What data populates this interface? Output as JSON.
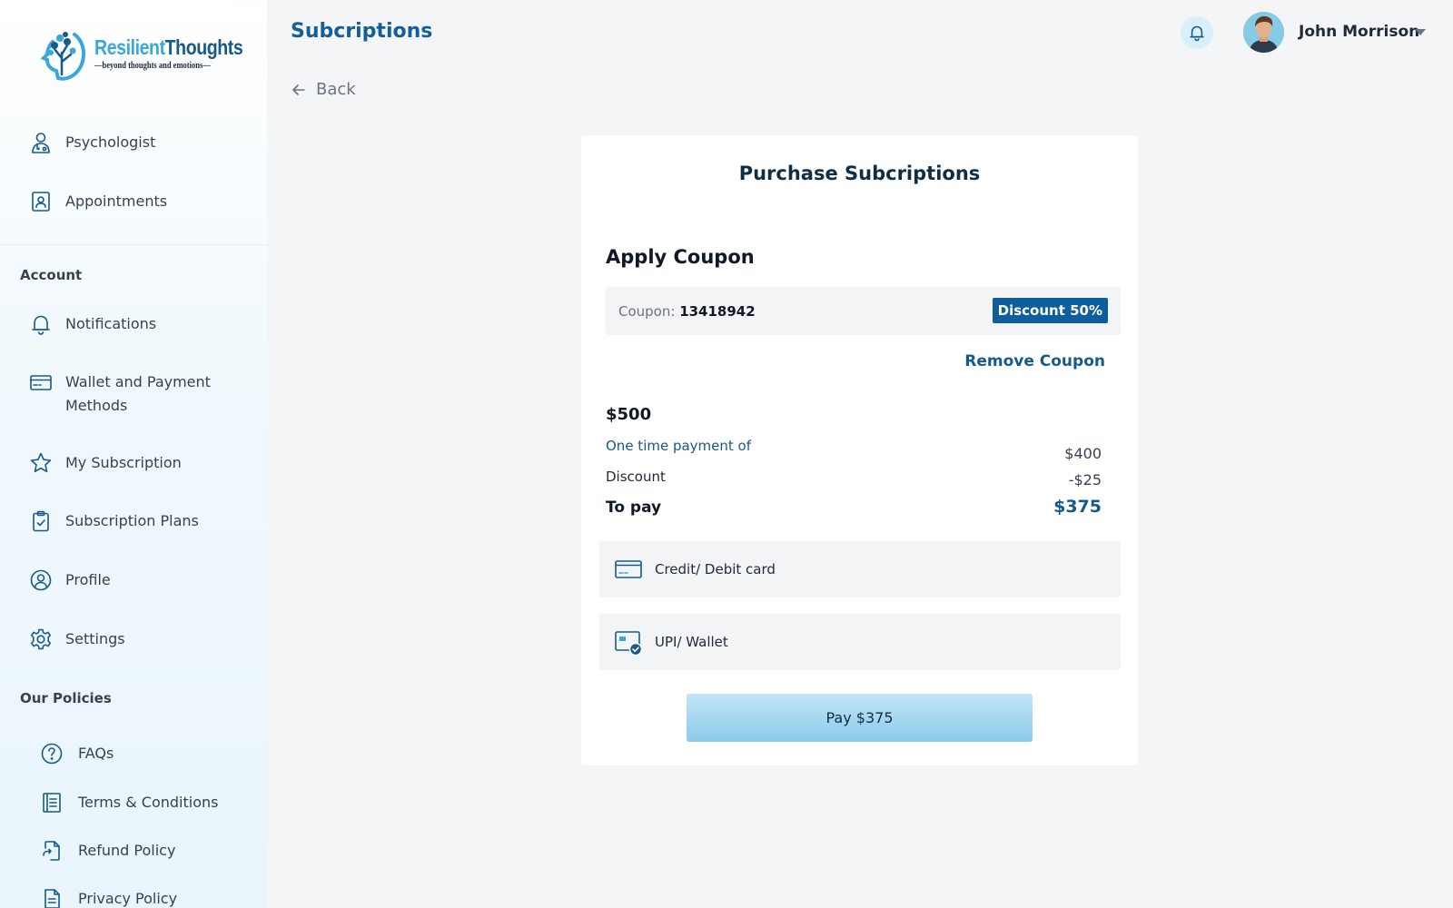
{
  "brand": {
    "name_part1": "Resilient",
    "name_part2": "Thoughts",
    "tagline": "—beyond thoughts and emotions—"
  },
  "header": {
    "title": "Subcriptions",
    "user_name": "John Morrison",
    "back_label": "Back"
  },
  "sidebar": {
    "main_items": [
      {
        "label": "Psychologist",
        "icon": "psychologist-icon"
      },
      {
        "label": "Appointments",
        "icon": "appointments-icon"
      }
    ],
    "account_heading": "Account",
    "account_items": [
      {
        "label": "Notifications",
        "icon": "bell-icon"
      },
      {
        "label": "Wallet and Payment Methods",
        "icon": "wallet-icon"
      },
      {
        "label": "My Subscription",
        "icon": "star-icon"
      },
      {
        "label": "Subscription Plans",
        "icon": "clipboard-icon"
      },
      {
        "label": "Profile",
        "icon": "profile-icon"
      },
      {
        "label": "Settings",
        "icon": "gear-icon"
      }
    ],
    "policies_heading": "Our Policies",
    "policy_items": [
      {
        "label": "FAQs",
        "icon": "question-icon"
      },
      {
        "label": "Terms & Conditions",
        "icon": "document-list-icon"
      },
      {
        "label": "Refund Policy",
        "icon": "refund-icon"
      },
      {
        "label": "Privacy Policy",
        "icon": "privacy-doc-icon"
      }
    ]
  },
  "purchase": {
    "title": "Purchase Subcriptions",
    "coupon_heading": "Apply Coupon",
    "coupon_label": "Coupon: ",
    "coupon_code": "13418942",
    "discount_badge": "Discount 50%",
    "remove_coupon": "Remove Coupon",
    "total_amount": "$500",
    "one_time_label": "One time payment of",
    "one_time_value": "$400",
    "discount_label": "Discount",
    "discount_value": "-$25",
    "to_pay_label": "To pay",
    "to_pay_value": "$375",
    "methods": [
      {
        "label": "Credit/ Debit card",
        "icon": "credit-card-icon"
      },
      {
        "label": "UPI/ Wallet",
        "icon": "upi-wallet-icon"
      }
    ],
    "pay_button": "Pay $375"
  },
  "colors": {
    "brand_blue": "#155a8a",
    "accent_light": "#3aa6db",
    "badge_bg": "#0e5d9c",
    "pay_button_top": "#c3e5f6",
    "pay_button_bottom": "#8ccbea"
  }
}
